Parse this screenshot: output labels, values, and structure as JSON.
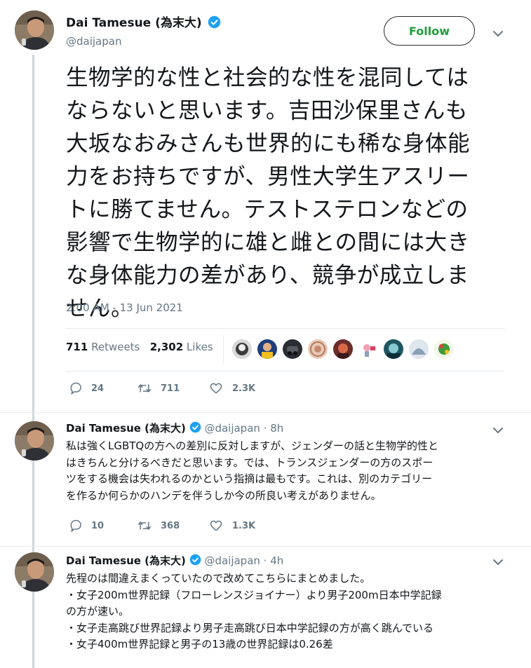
{
  "main_tweet": {
    "name": "Dai Tamesue (為末大)",
    "handle": "@daijapan",
    "follow_label": "Follow",
    "text": "生物学的な性と社会的な性を混同しては\nならないと思います。吉田沙保里さんも\n大坂なおみさんも世界的にも稀な身体能\n力をお持ちですが、男性大学生アスリー\nトに勝てません。テストステロンなどの\n影響で生物学的に雄と雌との間には大き\nな身体能力の差があり、競争が成立しま\nせん。",
    "timestamp": "2:00 AM - 13 Jun 2021",
    "retweets_count": "711",
    "retweets_label": "Retweets",
    "likes_count": "2,302",
    "likes_label": "Likes",
    "reply_count": "24",
    "retweet_count_small": "711",
    "like_count_small": "2.3K"
  },
  "replies": [
    {
      "name": "Dai Tamesue (為末大)",
      "handle": "@daijapan",
      "time": "· 8h",
      "text": "私は強くLGBTQの方への差別に反対しますが、ジェンダーの話と生物学的性と\nはきちんと分けるべきだと思います。では、トランスジェンダーの方のスポー\nツをする機会は失われるのかという指摘は最もです。これは、別のカテゴリー\nを作るか何らかのハンデを伴うしか今の所良い考えがありません。",
      "reply_count": "10",
      "retweet_count": "368",
      "like_count": "1.3K"
    },
    {
      "name": "Dai Tamesue (為末大)",
      "handle": "@daijapan",
      "time": "· 4h",
      "text": "先程のは間違えまくっていたので改めてこちらにまとめました。\n・女子200m世界記録（フローレンスジョイナー）より男子200m日本中学記録\nの方が速い。\n・女子走高跳び世界記録より男子走高跳び日本中学記録の方が高く跳んでいる\n・女子400m世界記録と男子の13歳の世界記録は0.26差"
    }
  ],
  "colors": {
    "text": "#14171a",
    "secondary": "#657786",
    "verified": "#1da1f2",
    "follow_text": "#1f9e3a",
    "thread_line": "#ccd6dd"
  }
}
